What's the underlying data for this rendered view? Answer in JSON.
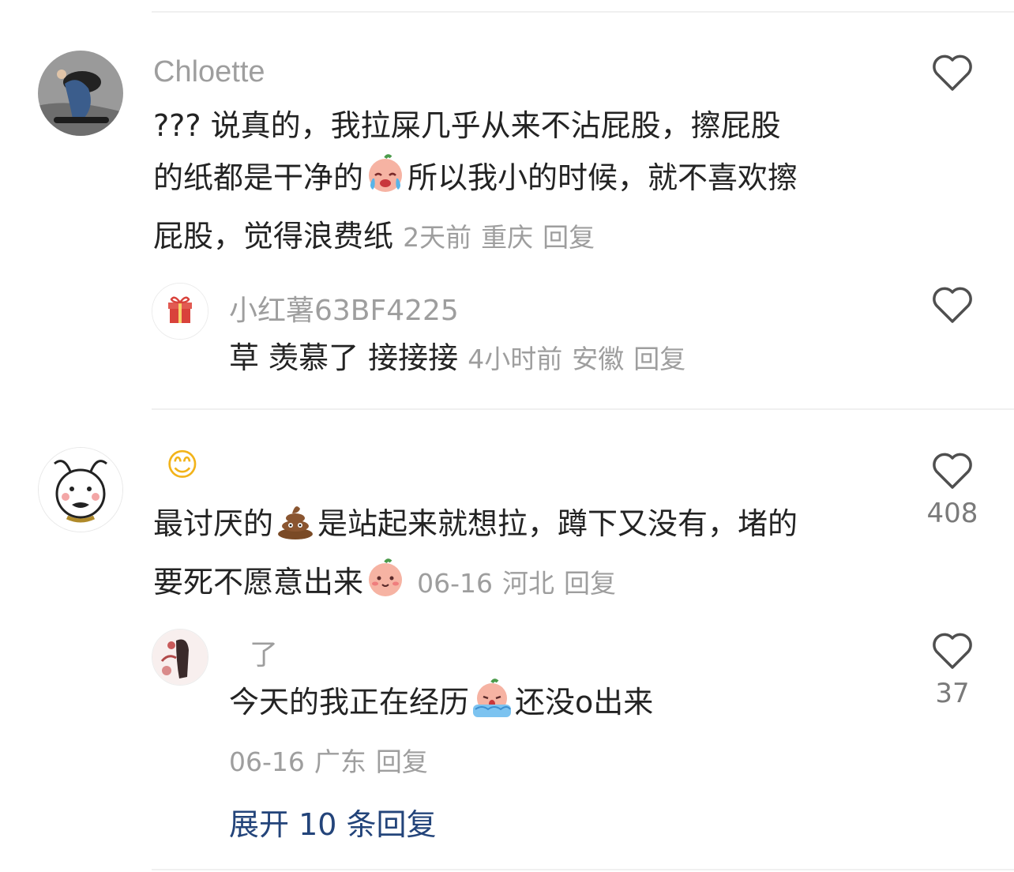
{
  "comments": [
    {
      "name": "Chloette",
      "text_line1": "??? 说真的，我拉屎几乎从来不沾屁股，擦屁股",
      "text_line2a": "的纸都是干净的",
      "text_line2b": "所以我小的时候，就不喜欢擦",
      "text_line3": "屁股，觉得浪费纸",
      "time": "2天前",
      "location": "重庆",
      "reply_label": "回复",
      "likes": "",
      "reply": {
        "name": "小红薯63BF4225",
        "text": "草 羡慕了 接接接",
        "time": "4小时前",
        "location": "安徽",
        "reply_label": "回复",
        "likes": ""
      }
    },
    {
      "name_emoji": "😊",
      "text_line1a": "最讨厌的",
      "text_line1b": "是站起来就想拉，蹲下又没有，堵的",
      "text_line2": "要死不愿意出来",
      "time": "06-16",
      "location": "河北",
      "reply_label": "回复",
      "likes": "408",
      "reply": {
        "name": "了",
        "text_a": "今天的我正在经历",
        "text_b": "还没o出来",
        "time": "06-16",
        "location": "广东",
        "reply_label": "回复",
        "likes": "37"
      },
      "expand_label": "展开 10 条回复"
    }
  ],
  "icons": {
    "like": "heart-outline-icon",
    "cry_emoji": "crying-face-emoji",
    "poop_emoji": "poop-emoji",
    "smile_emoji": "shy-face-emoji",
    "despair_emoji": "despair-face-emoji",
    "gift_avatar": "gift-icon"
  },
  "colors": {
    "text": "#232323",
    "meta": "#9e9e9e",
    "link": "#23447a"
  }
}
